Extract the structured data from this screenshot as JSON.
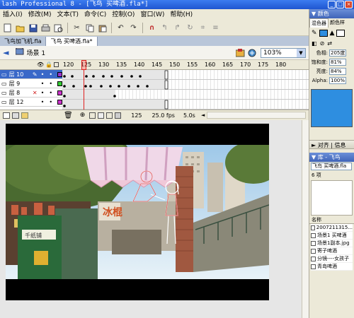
{
  "window": {
    "title": "lash Professional 8 - [飞鸟  买啤酒.fla*]"
  },
  "menu": [
    "插入(I)",
    "修改(M)",
    "文本(T)",
    "命令(C)",
    "控制(O)",
    "窗口(W)",
    "帮助(H)"
  ],
  "document_tabs": [
    "飞鸟加飞机.fla",
    "飞鸟  买啤酒.fla*"
  ],
  "scene": {
    "label": "场景 1",
    "zoom": "103%"
  },
  "timeline": {
    "frame_numbers": [
      "120",
      "125",
      "130",
      "135",
      "140",
      "145",
      "150",
      "155",
      "160",
      "165",
      "170",
      "175",
      "180"
    ],
    "layers": [
      {
        "name": "层 10",
        "selected": true,
        "color": "#9933cc"
      },
      {
        "name": "层 9",
        "selected": false,
        "color": "#33cc33"
      },
      {
        "name": "层 8",
        "selected": false,
        "color": "#cc33cc"
      },
      {
        "name": "层 12",
        "selected": false,
        "color": "#cc33cc"
      }
    ],
    "current_frame": "125",
    "fps": "25.0 fps",
    "time": "5.0s"
  },
  "color_panel": {
    "title": "颜色",
    "tabs": [
      "混色器",
      "颜色样"
    ],
    "hue_label": "色相:",
    "hue": "205度",
    "saturation_label": "饱和度:",
    "saturation": "81%",
    "brightness_label": "亮度:",
    "brightness": "84%",
    "alpha_label": "Alpha:",
    "alpha": "100%",
    "swatch_color": "#2e8ee0"
  },
  "align_panel": {
    "title": "对齐 | 信息"
  },
  "library_panel": {
    "title": "库 - 飞鸟",
    "doc_select": "飞鸟  买啤酒.fla",
    "count": "6 项",
    "col_header": "名称",
    "items": [
      "2007211315...",
      "场景1  买啤酒",
      "场景1副本.jpg",
      "寄子啤酒",
      "分镜----女孩子",
      "青岛啤酒"
    ]
  },
  "stage": {
    "shop_sign_text": "冰棍",
    "box_sign_text": "千纸铺"
  }
}
